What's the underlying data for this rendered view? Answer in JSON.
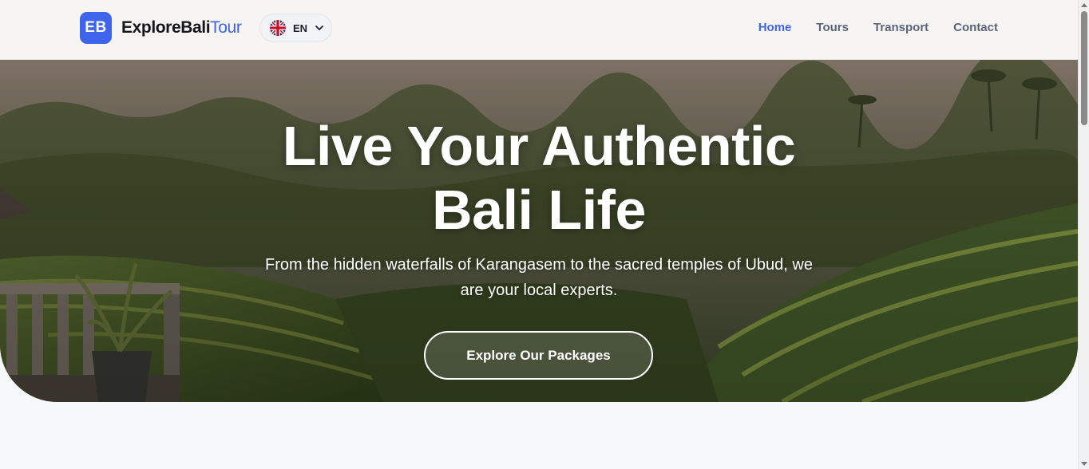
{
  "brand": {
    "badge": "EB",
    "name_main": "ExploreBali",
    "name_accent": "Tour",
    "accent_color": "#3f64ec"
  },
  "language": {
    "code": "EN",
    "flag_icon": "uk-flag-icon"
  },
  "nav": {
    "items": [
      {
        "label": "Home",
        "active": true
      },
      {
        "label": "Tours",
        "active": false
      },
      {
        "label": "Transport",
        "active": false
      },
      {
        "label": "Contact",
        "active": false
      }
    ]
  },
  "hero": {
    "title_line1": "Live Your Authentic",
    "title_line2": "Bali Life",
    "subtitle": "From the hidden waterfalls of Karangasem to the sacred temples of Ubud, we are your local experts.",
    "cta_label": "Explore Our Packages"
  }
}
